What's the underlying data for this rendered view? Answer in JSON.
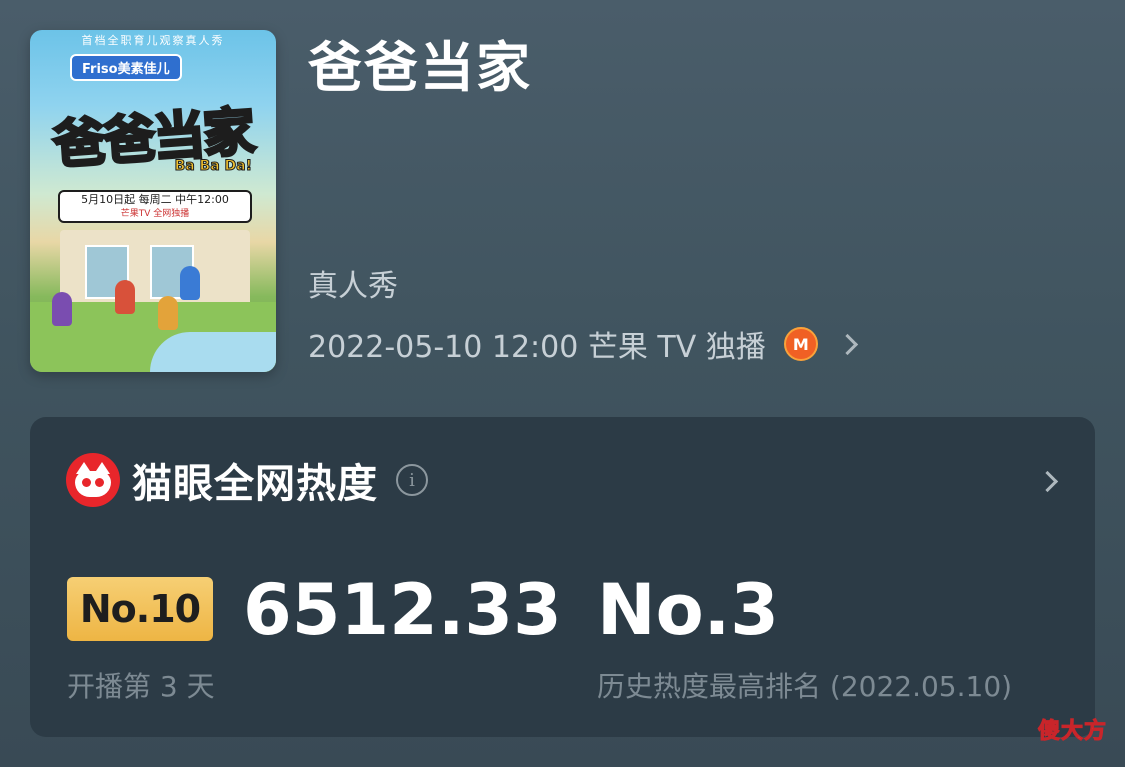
{
  "poster": {
    "top_strip": "首档全职育儿观察真人秀",
    "brand": "Friso美素佳儿",
    "logo_text": "爸爸当家",
    "sub_logo": "Ba Ba Da!",
    "schedule_line1": "5月10日起 每周二 中午12:00",
    "schedule_line2": "芒果TV 全网独播"
  },
  "show": {
    "title": "爸爸当家",
    "genre": "真人秀",
    "release": "2022-05-10 12:00 芒果 TV 独播",
    "platform_icon": "mango-tv-icon",
    "platform_icon_glyph": "M"
  },
  "heat_card": {
    "title": "猫眼全网热度",
    "info_glyph": "i",
    "rank_badge": "No.10",
    "heat_value": "6512.33",
    "days_label": "开播第 3 天",
    "history_rank": "No.3",
    "history_label": "历史热度最高排名 (2022.05.10)"
  },
  "watermark": "傻大方",
  "colors": {
    "background": "#40545f",
    "card": "#2c3b46",
    "badge": "#eeb544",
    "maoyan_red": "#e8262b",
    "mango_orange": "#f06024"
  }
}
